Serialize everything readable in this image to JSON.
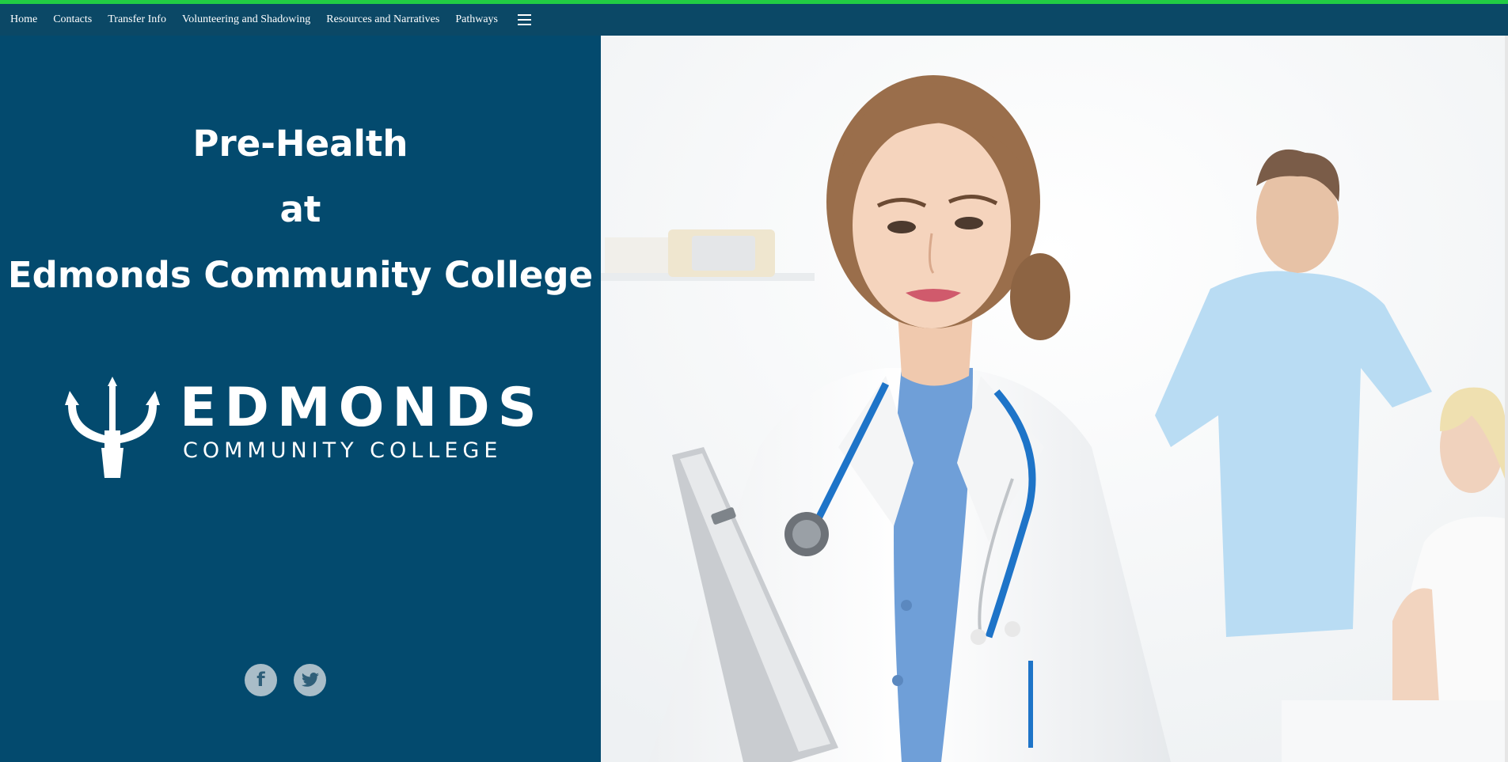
{
  "nav": {
    "items": [
      {
        "label": "Home"
      },
      {
        "label": "Contacts"
      },
      {
        "label": "Transfer Info"
      },
      {
        "label": "Volunteering and Shadowing"
      },
      {
        "label": "Resources and Narratives"
      },
      {
        "label": "Pathways"
      }
    ],
    "menu_icon": "hamburger-menu-icon"
  },
  "hero": {
    "title_lines": [
      "Pre-Health",
      "at",
      "Edmonds Community College"
    ]
  },
  "logo": {
    "wordmark": "EDMONDS",
    "subline": "COMMUNITY COLLEGE",
    "icon": "trident-icon"
  },
  "social": {
    "facebook_icon": "facebook-icon",
    "twitter_icon": "twitter-icon"
  },
  "colors": {
    "accent": "#22cc44",
    "navbar": "#0b4866",
    "panel": "#034a6e",
    "social_circle": "#a9bdc8"
  }
}
